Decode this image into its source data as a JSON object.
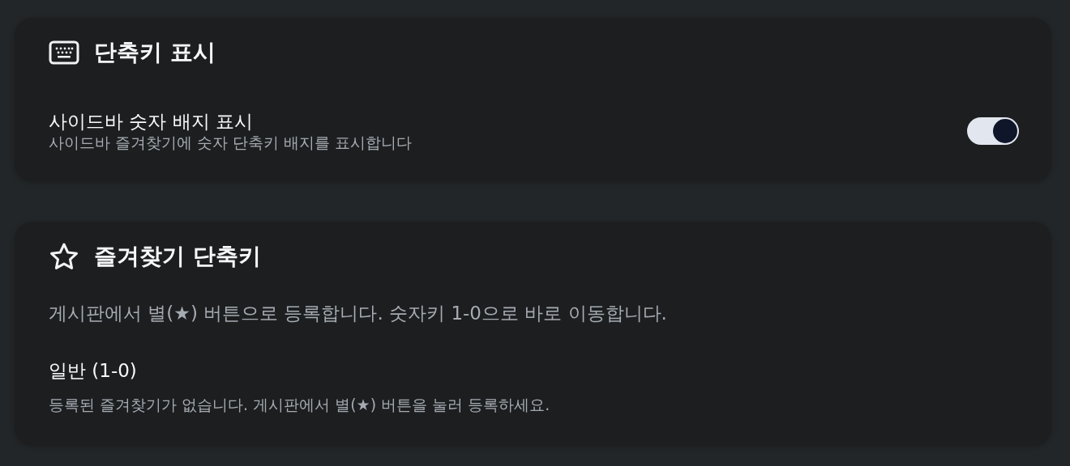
{
  "sections": [
    {
      "title": "단축키 표시",
      "items": [
        {
          "kind": "toggle",
          "label": "사이드바 숫자 배지 표시",
          "description": "사이드바 즐겨찾기에 숫자 단축키 배지를 표시합니다",
          "on": true
        }
      ]
    },
    {
      "title": "즐겨찾기 단축키",
      "items": [
        {
          "kind": "note",
          "text": "게시판에서 별(★) 버튼으로 등록합니다. 숫자키 1-0으로 바로 이동합니다."
        },
        {
          "kind": "group",
          "title": "일반 (1-0)",
          "empty_text": "등록된 즐겨찾기가 없습니다. 게시판에서 별(★) 버튼을 눌러 등록하세요."
        }
      ]
    }
  ]
}
